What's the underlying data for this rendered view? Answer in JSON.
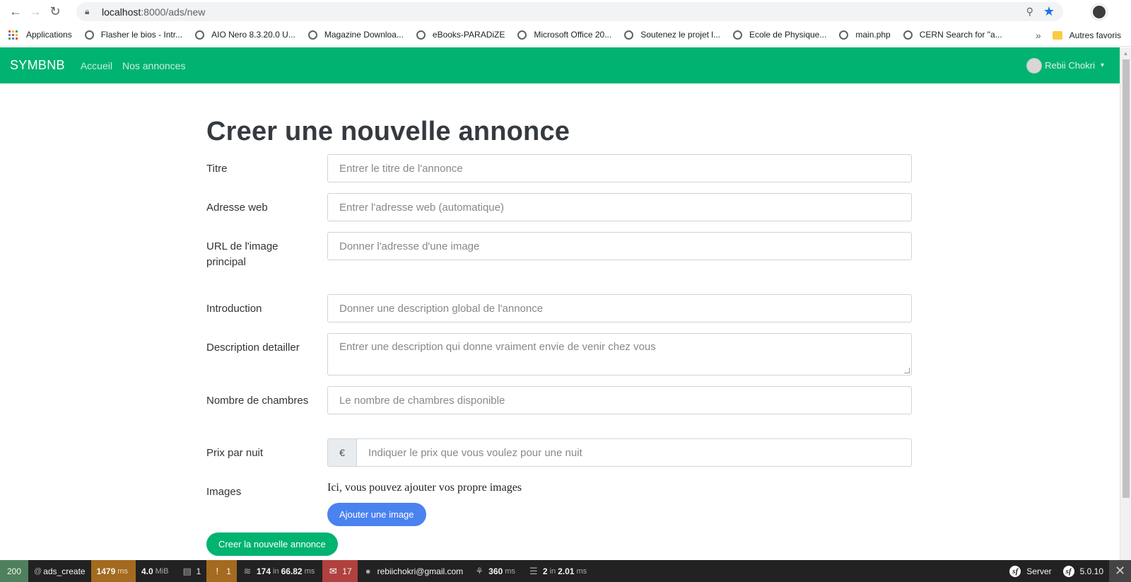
{
  "browser": {
    "url_host": "localhost",
    "url_path": ":8000/ads/new",
    "bookmarks": [
      "Applications",
      "Flasher le bios - Intr...",
      "AIO Nero 8.3.20.0 U...",
      "Magazine Downloa...",
      "eBooks-PARADiZE",
      "Microsoft Office 20...",
      "Soutenez le projet l...",
      "Ecole de Physique...",
      "main.php",
      "CERN Search for \"a..."
    ],
    "other_bookmarks": "Autres favoris",
    "more_chevron": "»"
  },
  "navbar": {
    "brand": "SYMBNB",
    "links": [
      "Accueil",
      "Nos annonces"
    ],
    "user_name": "Rebii Chokri",
    "caret": "▾"
  },
  "form": {
    "title": "Creer une nouvelle annonce",
    "fields": {
      "titre": {
        "label": "Titre",
        "placeholder": "Entrer le titre de l'annonce"
      },
      "slug": {
        "label": "Adresse web",
        "placeholder": "Entrer l'adresse web (automatique)"
      },
      "cover": {
        "label": "URL de l'image principal",
        "placeholder": "Donner l'adresse d'une image"
      },
      "intro": {
        "label": "Introduction",
        "placeholder": "Donner une description global de l'annonce"
      },
      "content": {
        "label": "Description detailler",
        "placeholder": "Entrer une description qui donne vraiment envie de venir chez vous"
      },
      "rooms": {
        "label": "Nombre de chambres",
        "placeholder": "Le nombre de chambres disponible"
      },
      "price": {
        "label": "Prix par nuit",
        "placeholder": "Indiquer le prix que vous voulez pour une nuit",
        "addon": "€"
      },
      "images": {
        "label": "Images",
        "help": "Ici, vous pouvez ajouter vos propre images",
        "add_button": "Ajouter une image"
      }
    },
    "submit": "Creer la nouvelle annonce"
  },
  "toolbar": {
    "status": "200",
    "route": "ads_create",
    "time_value": "1479",
    "time_unit": "ms",
    "memory_value": "4.0",
    "memory_unit": "MiB",
    "forms": "1",
    "warnings": "1",
    "db_queries": "174",
    "db_in": "in",
    "db_time": "66.82",
    "db_unit": "ms",
    "translations": "17",
    "user": "rebiichokri@gmail.com",
    "twig_time": "360",
    "twig_unit": "ms",
    "cache_count": "2",
    "cache_in": "in",
    "cache_time": "2.01",
    "cache_unit": "ms",
    "server": "Server",
    "version": "5.0.10",
    "close": "✕"
  }
}
